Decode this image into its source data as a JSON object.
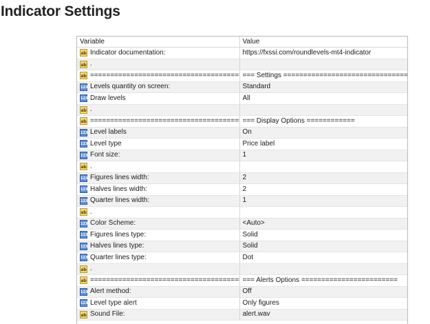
{
  "page": {
    "heading": "Indicator Settings"
  },
  "table": {
    "columns": [
      "Variable",
      "Value"
    ],
    "icons": {
      "string": "ab",
      "number": "123"
    },
    "rows": [
      {
        "type": "string",
        "variable": "Indicator documentation:",
        "value": "https://fxssi.com/roundlevels-mt4-indicator"
      },
      {
        "type": "string",
        "variable": ".",
        "value": ""
      },
      {
        "type": "string",
        "variable": "===========================================...",
        "value": "=== Settings ====================================="
      },
      {
        "type": "number",
        "variable": "Levels quantity on screen:",
        "value": "Standard"
      },
      {
        "type": "number",
        "variable": "Draw levels",
        "value": "All"
      },
      {
        "type": "string",
        "variable": ".",
        "value": ""
      },
      {
        "type": "string",
        "variable": "===========================================...",
        "value": "=== Display Options ============"
      },
      {
        "type": "number",
        "variable": "Level labels",
        "value": "On"
      },
      {
        "type": "number",
        "variable": "Level type",
        "value": "Price label"
      },
      {
        "type": "number",
        "variable": "Font size:",
        "value": "1"
      },
      {
        "type": "string",
        "variable": ".",
        "value": ""
      },
      {
        "type": "number",
        "variable": "Figures lines width:",
        "value": "2"
      },
      {
        "type": "number",
        "variable": "Halves lines width:",
        "value": "2"
      },
      {
        "type": "number",
        "variable": "Quarter lines width:",
        "value": "1"
      },
      {
        "type": "string",
        "variable": ".",
        "value": ""
      },
      {
        "type": "number",
        "variable": "Color Scheme:",
        "value": "<Auto>"
      },
      {
        "type": "number",
        "variable": "Figures lines type:",
        "value": "Solid"
      },
      {
        "type": "number",
        "variable": "Halves lines type:",
        "value": "Solid"
      },
      {
        "type": "number",
        "variable": "Quarter lines type:",
        "value": "Dot"
      },
      {
        "type": "string",
        "variable": ".",
        "value": ""
      },
      {
        "type": "string",
        "variable": "===========================================...",
        "value": "=== Alerts Options ========================"
      },
      {
        "type": "number",
        "variable": "Alert method:",
        "value": "Off"
      },
      {
        "type": "number",
        "variable": "Level type alert",
        "value": "Only figures"
      },
      {
        "type": "string",
        "variable": "Sound File:",
        "value": "alert.wav"
      }
    ]
  }
}
